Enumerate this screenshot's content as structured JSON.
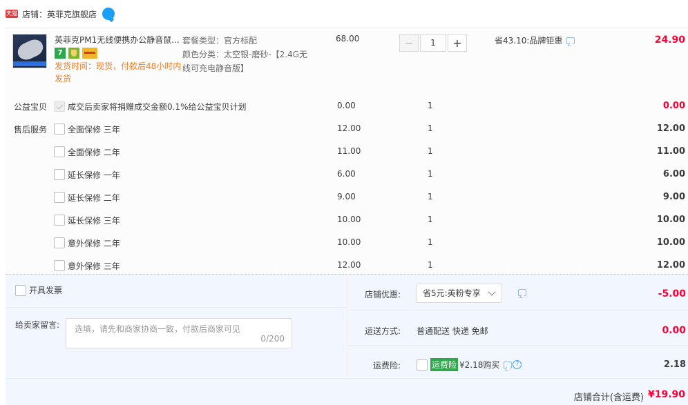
{
  "shop": {
    "badge": "天猫",
    "name": "店铺：英菲克旗舰店"
  },
  "product": {
    "title": "英菲克PM1无线便携办公静音鼠...",
    "tag_seven": "7",
    "ship_time": "发货时间：现货，付款后48小时内发货",
    "sku_type": "套餐类型：官方标配",
    "sku_color": "颜色分类：太空银-磨砂-【2.4G无线可充电静音版】",
    "price": "68.00",
    "quantity": "1",
    "qty_minus": "−",
    "qty_plus": "+",
    "promo": "省43.10:品牌钜惠",
    "subtotal": "24.90"
  },
  "charity": {
    "label": "公益宝贝",
    "name": "成交后卖家将捐赠成交金额0.1%给公益宝贝计划",
    "price": "0.00",
    "qty": "1",
    "sum": "0.00"
  },
  "aftersale": {
    "label": "售后服务",
    "items": [
      {
        "name": "全面保修 三年",
        "price": "12.00",
        "qty": "1",
        "sum": "12.00"
      },
      {
        "name": "全面保修 二年",
        "price": "11.00",
        "qty": "1",
        "sum": "11.00"
      },
      {
        "name": "延长保修 一年",
        "price": "6.00",
        "qty": "1",
        "sum": "6.00"
      },
      {
        "name": "延长保修 二年",
        "price": "9.00",
        "qty": "1",
        "sum": "9.00"
      },
      {
        "name": "延长保修 三年",
        "price": "10.00",
        "qty": "1",
        "sum": "10.00"
      },
      {
        "name": "意外保修 二年",
        "price": "10.00",
        "qty": "1",
        "sum": "10.00"
      },
      {
        "name": "意外保修 三年",
        "price": "12.00",
        "qty": "1",
        "sum": "12.00"
      }
    ]
  },
  "invoice": {
    "label": "开具发票"
  },
  "message": {
    "label": "给卖家留言:",
    "placeholder": "选填，请先和商家协商一致，付款后商家可见",
    "count": "0/200"
  },
  "discount": {
    "label": "店铺优惠:",
    "selected": "省5元:英粉专享",
    "amount": "-5.00"
  },
  "shipping": {
    "label": "运送方式:",
    "method": "普通配送 快递 免邮",
    "amount": "0.00"
  },
  "insurance": {
    "label": "运费险:",
    "badge": "运费险",
    "text": "¥2.18购买",
    "amount": "2.18"
  },
  "total": {
    "label": "店铺合计(含运费)",
    "value": "¥19.90"
  },
  "colors": {
    "accent_red": "#ff0036",
    "ship_orange": "#f07e2a",
    "panel_blue": "#f2f7ff",
    "insurance_green": "#2ea84a"
  }
}
